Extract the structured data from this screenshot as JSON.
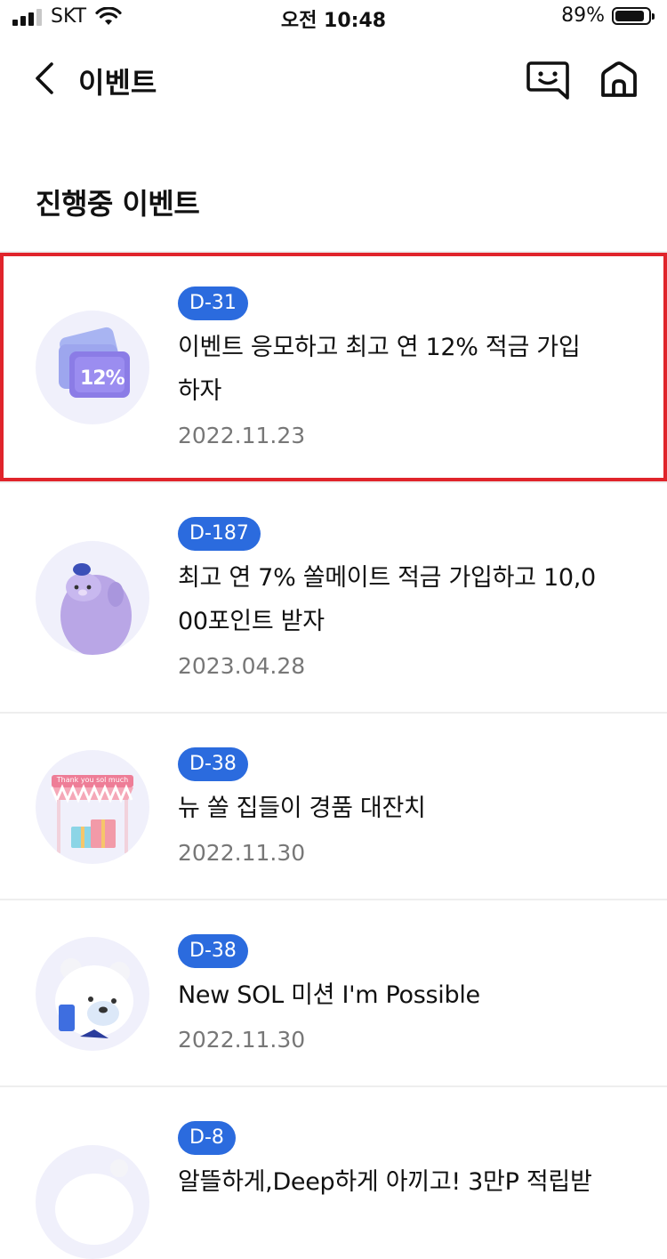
{
  "status_bar": {
    "carrier": "SKT",
    "time": "오전 10:48",
    "battery_percent_label": "89%",
    "battery_level": 0.89
  },
  "nav": {
    "title": "이벤트"
  },
  "section": {
    "title": "진행중 이벤트"
  },
  "events": [
    {
      "badge": "D-31",
      "title": "이벤트 응모하고 최고 연 12% 적금 가입하자",
      "date": "2022.11.23",
      "thumb_label": "12%"
    },
    {
      "badge": "D-187",
      "title": "최고 연 7% 쏠메이트 적금 가입하고 10,000포인트 받자",
      "date": "2023.04.28"
    },
    {
      "badge": "D-38",
      "title": "뉴 쏠 집들이 경품 대잔치",
      "date": "2022.11.30",
      "thumb_label": "Thank you sol much"
    },
    {
      "badge": "D-38",
      "title": "New SOL 미션 I'm Possible",
      "date": "2022.11.30"
    },
    {
      "badge": "D-8",
      "title": "알뜰하게,Deep하게 아끼고! 3만P 적립받"
    }
  ],
  "colors": {
    "badge_bg": "#2b6bde",
    "highlight_border": "#e0242b",
    "date_text": "#777777"
  }
}
